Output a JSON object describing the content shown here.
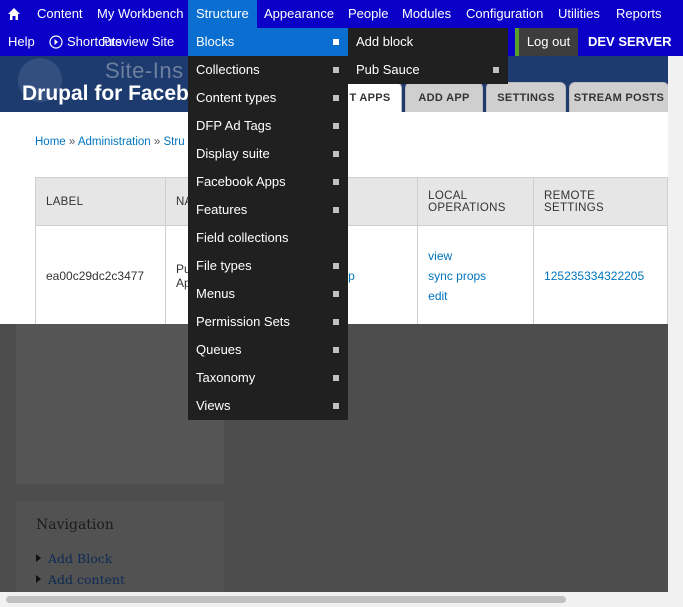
{
  "admin_menu": {
    "items": [
      {
        "label": "Content"
      },
      {
        "label": "My Workbench"
      },
      {
        "label": "Structure"
      },
      {
        "label": "Appearance"
      },
      {
        "label": "People"
      },
      {
        "label": "Modules"
      },
      {
        "label": "Configuration"
      },
      {
        "label": "Utilities"
      },
      {
        "label": "Reports"
      }
    ],
    "home_icon": "home-icon"
  },
  "second_bar": {
    "help": "Help",
    "shortcuts": "Shortcuts",
    "preview": "Preview Site",
    "logout": "Log out",
    "server": "DEV SERVER"
  },
  "header": {
    "logo_text": "Site-Ins",
    "site_title": "Drupal for Facebook"
  },
  "tabs": [
    {
      "label": "T APPS"
    },
    {
      "label": "ADD APP"
    },
    {
      "label": "SETTINGS"
    },
    {
      "label": "STREAM POSTS"
    }
  ],
  "breadcrumb": {
    "home": "Home",
    "admin": "Administration",
    "structure": "Stru"
  },
  "table": {
    "headers": [
      "LABEL",
      "NA",
      "",
      "LOCAL OPERATIONS",
      "REMOTE SETTINGS"
    ],
    "row": {
      "label": "ea00c29dc2c3477",
      "name_line1": "Pu",
      "name_line2": "Ap",
      "machine": "n_test_app",
      "ops": [
        "view",
        "sync props",
        "edit"
      ],
      "remote": "125235334322205"
    }
  },
  "structure_menu": [
    {
      "label": "Blocks"
    },
    {
      "label": "Collections"
    },
    {
      "label": "Content types"
    },
    {
      "label": "DFP Ad Tags"
    },
    {
      "label": "Display suite"
    },
    {
      "label": "Facebook Apps"
    },
    {
      "label": "Features"
    },
    {
      "label": "Field collections"
    },
    {
      "label": "File types"
    },
    {
      "label": "Menus"
    },
    {
      "label": "Permission Sets"
    },
    {
      "label": "Queues"
    },
    {
      "label": "Taxonomy"
    },
    {
      "label": "Views"
    }
  ],
  "blocks_submenu": [
    {
      "label": "Add block"
    },
    {
      "label": "Pub Sauce"
    }
  ],
  "navigation": {
    "title": "Navigation",
    "items": [
      {
        "label": "Add Block"
      },
      {
        "label": "Add content"
      }
    ]
  },
  "colors": {
    "admin_bar": "#0a00c8",
    "active_item": "#0a6fd1",
    "dropdown_bg": "#202020",
    "header_bg": "#1d3b6f",
    "link": "#0074bd"
  }
}
